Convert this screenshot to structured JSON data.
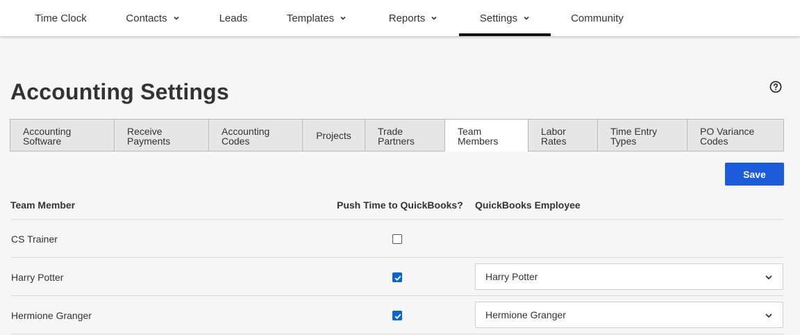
{
  "nav": {
    "items": [
      {
        "label": "Time Clock",
        "has_dropdown": false
      },
      {
        "label": "Contacts",
        "has_dropdown": true
      },
      {
        "label": "Leads",
        "has_dropdown": false
      },
      {
        "label": "Templates",
        "has_dropdown": true
      },
      {
        "label": "Reports",
        "has_dropdown": true
      },
      {
        "label": "Settings",
        "has_dropdown": true,
        "active": true
      },
      {
        "label": "Community",
        "has_dropdown": false
      }
    ]
  },
  "page": {
    "title": "Accounting Settings",
    "help_icon": "question-circle-icon"
  },
  "tabs": [
    {
      "line1": "Accounting",
      "line2": "Software"
    },
    {
      "line1": "Receive",
      "line2": "Payments"
    },
    {
      "line1": "Accounting",
      "line2": "Codes"
    },
    {
      "line1": "Projects",
      "line2": ""
    },
    {
      "line1": "Trade",
      "line2": "Partners"
    },
    {
      "line1": "Team",
      "line2": "Members",
      "active": true
    },
    {
      "line1": "Labor",
      "line2": "Rates"
    },
    {
      "line1": "Time Entry",
      "line2": "Types"
    },
    {
      "line1": "PO Variance",
      "line2": "Codes"
    }
  ],
  "toolbar": {
    "save_label": "Save"
  },
  "table": {
    "headers": {
      "team_member": "Team Member",
      "push_time": "Push Time to QuickBooks?",
      "qb_employee": "QuickBooks Employee"
    },
    "rows": [
      {
        "name": "CS Trainer",
        "push": false,
        "employee": ""
      },
      {
        "name": "Harry Potter",
        "push": true,
        "employee": "Harry Potter"
      },
      {
        "name": "Hermione Granger",
        "push": true,
        "employee": "Hermione Granger"
      }
    ]
  },
  "colors": {
    "accent": "#1c5bd9",
    "checkbox": "#0b63d8",
    "nav_active_bar": "#111111"
  }
}
